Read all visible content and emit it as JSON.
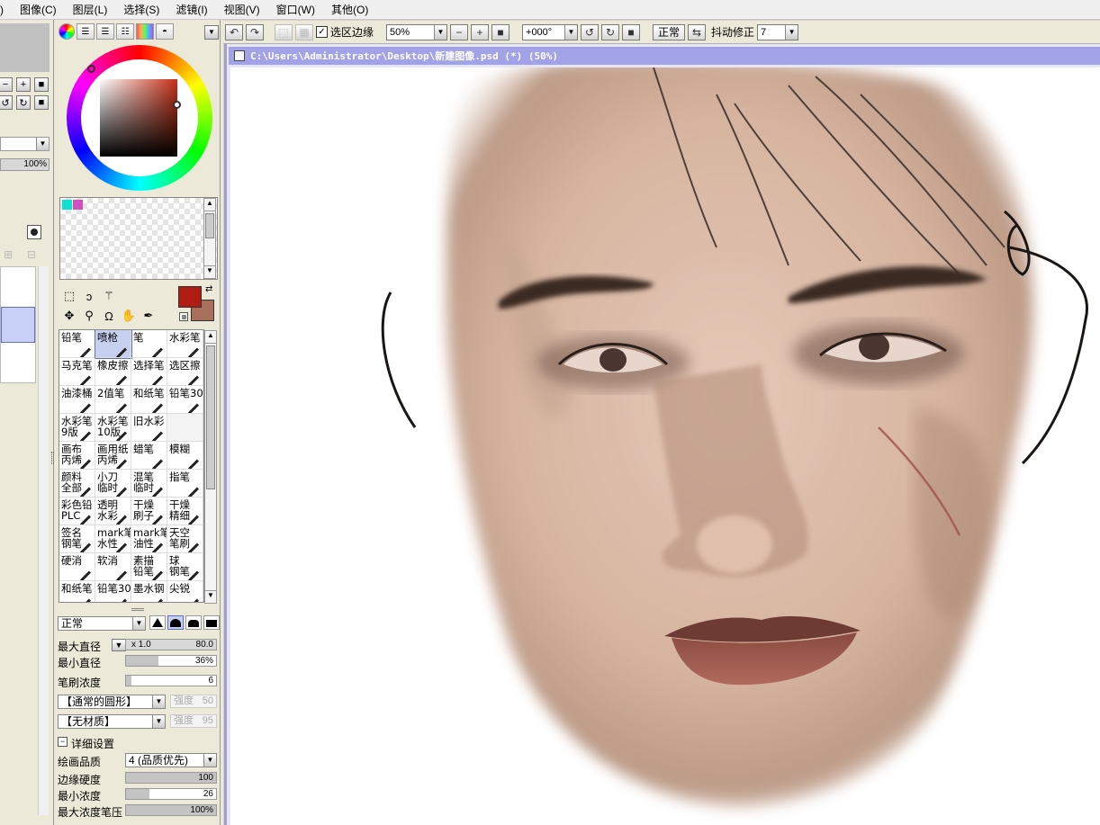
{
  "menu": [
    "图像(C)",
    "图层(L)",
    "选择(S)",
    "滤镜(I)",
    "视图(V)",
    "窗口(W)",
    "其他(O)"
  ],
  "menu_fragment": ")",
  "toolbar": {
    "selection_edge_label": "选区边缘",
    "zoom_value": "50%",
    "rotation_value": "+000°",
    "blend_label": "正常",
    "stabilizer_label": "抖动修正",
    "stabilizer_value": "7"
  },
  "left_strip": {
    "percent": "100%"
  },
  "window": {
    "title": "C:\\Users\\Administrator\\Desktop\\新建图像.psd (*) (50%)"
  },
  "colors": {
    "foreground": "#b01c14",
    "background": "#a96f5d",
    "swatch1": "#10e0d0",
    "swatch2": "#d050c0",
    "title_bar": "#a2a2e6"
  },
  "brushes": [
    [
      "铅笔",
      "喷枪",
      "笔",
      "水彩笔"
    ],
    [
      "马克笔",
      "橡皮擦",
      "选择笔",
      "选区擦"
    ],
    [
      "油漆桶",
      "2值笔",
      "和纸笔",
      "铅笔30"
    ],
    [
      "水彩笔\n9版",
      "水彩笔\n10版",
      "旧水彩",
      ""
    ],
    [
      "画布\n丙烯",
      "画用纸\n丙烯",
      "蜡笔",
      "模糊"
    ],
    [
      "颜料\n全部",
      "小刀\n临时",
      "混笔\n临时",
      "指笔"
    ],
    [
      "彩色铅\nPLC",
      "透明\n水彩",
      "干燥\n刷子",
      "干燥\n精细"
    ],
    [
      "签名\n钢笔",
      "mark笔\n水性",
      "mark笔\n油性",
      "天空\n笔刷"
    ],
    [
      "硬消",
      "软消",
      "素描\n铅笔",
      "球\n钢笔"
    ],
    [
      "和纸笔",
      "铅笔30",
      "墨水钢",
      "尖锐"
    ]
  ],
  "brush_settings": {
    "blend_mode": "正常",
    "max_size_label": "最大直径",
    "max_size_mult": "x 1.0",
    "max_size_value": "80.0",
    "min_size_label": "最小直径",
    "min_size_value": "36%",
    "min_size_level": 0.36,
    "density_label": "笔刷浓度",
    "density_value": "6",
    "density_level": 0.06,
    "shape_select": "【通常的圆形】",
    "shape_strength_label": "强度",
    "shape_strength_value": "50",
    "texture_select": "【无材质】",
    "texture_strength_label": "强度",
    "texture_strength_value": "95",
    "detail_header": "详细设置",
    "quality_label": "绘画品质",
    "quality_value": "4 (品质优先)",
    "edge_hardness_label": "边缘硬度",
    "edge_hardness_value": "100",
    "edge_hardness_level": 1.0,
    "min_density_label": "最小浓度",
    "min_density_value": "26",
    "min_density_level": 0.26,
    "max_pressure_label": "最大浓度笔压",
    "max_pressure_value": "100%",
    "max_pressure_level": 1.0
  }
}
